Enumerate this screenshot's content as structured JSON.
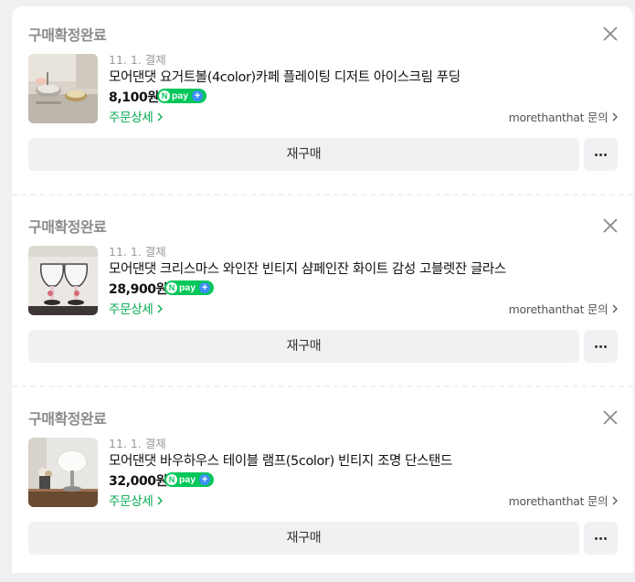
{
  "orders": [
    {
      "status": "구매확정완료",
      "date": "11. 1. 결제",
      "title": "모어댄댓 요거트볼(4color)카페 플레이팅 디저트 아이스크림 푸딩",
      "price": "8,100원",
      "npay_label": "pay",
      "detail_label": "주문상세",
      "seller_label": "morethanthat 문의",
      "rebuy_label": "재구매",
      "thumb_icon": "yogurt-bowl-photo"
    },
    {
      "status": "구매확정완료",
      "date": "11. 1. 결제",
      "title": "모어댄댓 크리스마스 와인잔 빈티지 샴페인잔 화이트 감성 고블렛잔 글라스",
      "price": "28,900원",
      "npay_label": "pay",
      "detail_label": "주문상세",
      "seller_label": "morethanthat 문의",
      "rebuy_label": "재구매",
      "thumb_icon": "goblet-glass-photo"
    },
    {
      "status": "구매확정완료",
      "date": "11. 1. 결제",
      "title": "모어댄댓 바우하우스 테이블 램프(5color) 빈티지 조명 단스탠드",
      "price": "32,000원",
      "npay_label": "pay",
      "detail_label": "주문상세",
      "seller_label": "morethanthat 문의",
      "rebuy_label": "재구매",
      "thumb_icon": "table-lamp-photo"
    }
  ],
  "colors": {
    "accent_green": "#03a94e",
    "npay_green": "#03c75a",
    "npay_plus_blue": "#3c8ff7",
    "status_gray": "#8b8b8b",
    "button_bg": "#f1f1f4"
  }
}
